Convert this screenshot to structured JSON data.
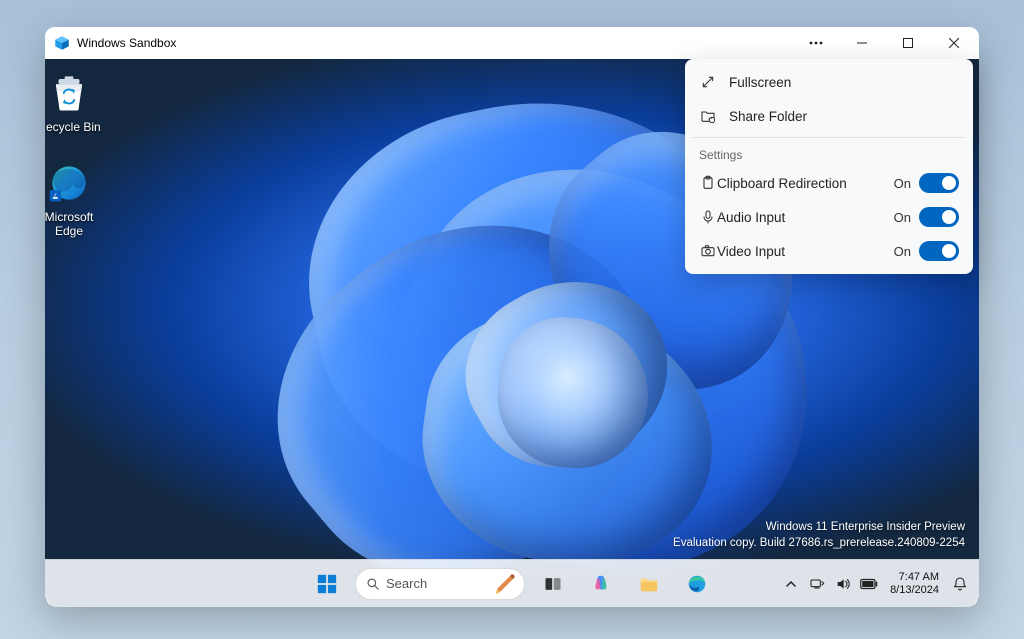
{
  "window": {
    "title": "Windows Sandbox"
  },
  "flyout": {
    "fullscreen": "Fullscreen",
    "shareFolder": "Share Folder",
    "settingsHeader": "Settings",
    "rows": [
      {
        "label": "Clipboard Redirection",
        "state": "On"
      },
      {
        "label": "Audio Input",
        "state": "On"
      },
      {
        "label": "Video Input",
        "state": "On"
      }
    ]
  },
  "desktop": {
    "recycleBin": "Recycle Bin",
    "edge": "Microsoft Edge"
  },
  "watermark": {
    "line1": "Windows 11 Enterprise Insider Preview",
    "line2": "Evaluation copy. Build 27686.rs_prerelease.240809-2254"
  },
  "taskbar": {
    "searchPlaceholder": "Search",
    "time": "7:47 AM",
    "date": "8/13/2024"
  }
}
